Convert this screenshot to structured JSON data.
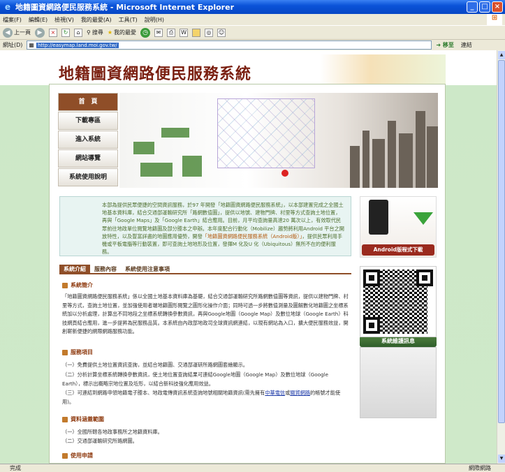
{
  "window": {
    "title": "地籍圖資網路便民服務系統 - Microsoft Internet Explorer"
  },
  "menu": [
    "檔案(F)",
    "編輯(E)",
    "檢視(V)",
    "我的最愛(A)",
    "工具(T)",
    "說明(H)"
  ],
  "toolbar": {
    "back": "上一頁",
    "search": "搜尋",
    "favorites": "我的最愛"
  },
  "address": {
    "label": "網址(D)",
    "url": "http://easymap.land.moi.gov.tw/",
    "go": "移至",
    "links": "連結"
  },
  "status": {
    "left": "完成",
    "zone": "網際網路"
  },
  "site": {
    "title": "地籍圖資網路便民服務系統"
  },
  "nav": [
    "首　頁",
    "下載專區",
    "進入系統",
    "網站導覽",
    "系統使用說明"
  ],
  "intro": {
    "p1": "本部為提供民眾便捷的空間資訊服務，於97 年開發「地籍圖資網路便民服務系統」，以本部建置完成之全國土地基本資料庫，結合交通部運輸研究所「路網數值圖」，提供以地號、建物門牌、村里等方式查詢土地位置，再與「Google Maps」及「Google Earth」結合應用。目前，月平均查詢量高達20 萬次以上，有效取代民眾前往地政單位閱覽地籍圖及部分謄本之申辦。本年度配合行動化（Mobilize）趨勢將利用Android 平台之開放特性，以及豐富詳盡的地圖應用優勢，開發",
    "hl": "「地籍圖資網路便民服務系統（Android版）」",
    "p2": "，提供民眾利用手機或平板電腦等行動裝置，即可查詢土地地形及位置，發揮M 化及U 化（Ubiquitous）無所不在的便利服務。"
  },
  "tabs": [
    "系統介紹",
    "服務內容",
    "系統使用注意事項"
  ],
  "sections": {
    "s1": "系統簡介",
    "s1_text": "「地籍圖資網路便民服務系統」係以全國土地基本資料庫為基礎，結合交通部運輸研究所路網數值圖等資訊，提供以建物門牌、村里等方式，查詢土地位置，並加強使用者端地籍圖形閱覽之圖形化操作介面；同時可透一步將數值測量及圖解數化地籍圖之坐標系統加以分析處理，計算出不同地段之坐標系統轉換參數資訊，再與Google地圖（Google Map）及數位地球（Google Earth）科技網頁結合應用，進一步提昇為民服務品質。本系統由內政部地政司全球資訊網連結，以現有網站為入口，擴大便民服務效益，開創嶄新便捷的網際網路服務功能。",
    "s2": "服務項目",
    "s2_items": [
      "（一）免費提供土地位置資訊查詢，並結合地籍圖、交通部運研所路網圖套繪顯示。",
      "（二）分析計算坐標系統轉換參數資訊，使土地位置查詢結果可連結Google地圖（Google Map）及數位地球（Google Earth），標示出概略宗地位置及坵形，以結合新科技強化應用效益。",
      "（三）可連結到網路申領地籍電子謄本、地政電傳資訊系統查詢地號相關地籍資訊(需先擁有"
    ],
    "s2_link1": "中華電信",
    "s2_mid": "或",
    "s2_link2": "關貿網路",
    "s2_tail": "的帳號才能使用)。",
    "s3": "資料涵蓋範圍",
    "s3_items": [
      "（一）全國所轄各地政事務所之地籍資料庫。",
      "（二）交通部運輸研究所路網圖。"
    ],
    "s4": "使用申請"
  },
  "side": {
    "android": "Android版程式下載",
    "maint": "系統維護訊息"
  }
}
